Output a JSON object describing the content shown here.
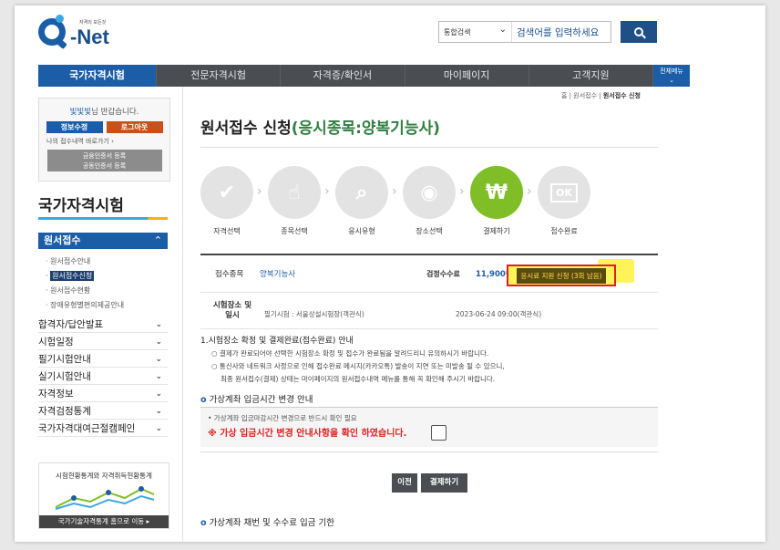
{
  "logo": {
    "tagline": "자격의 모든것",
    "name": "-Net"
  },
  "search": {
    "scope": "통합검색",
    "placeholder": "검색어를 입력하세요"
  },
  "nav": {
    "items": [
      "국가자격시험",
      "전문자격시험",
      "자격증/확인서",
      "마이페이지",
      "고객지원"
    ],
    "all_menu": "전체메뉴"
  },
  "user": {
    "name": "빛빛빛",
    "greeting": "님 반갑습니다.",
    "info_button": "정보수정",
    "logout_button": "로그아웃",
    "recent_link": "나의 접수내역 바로가기",
    "cert_button_line1": "금융인증서 등록",
    "cert_button_line2": "공동인증서 등록"
  },
  "sidebar": {
    "title": "국가자격시험",
    "section": "원서접수",
    "sub_items": [
      "원서접수안내",
      "원서접수신청",
      "원서접수현황",
      "장애유형별편의제공안내"
    ],
    "main_items": [
      "합격자/답안발표",
      "시험일정",
      "필기시험안내",
      "실기시험안내",
      "자격정보",
      "자격검정통계",
      "국가자격대여근절캠페인"
    ],
    "stats_title": "시험현황통계와 자격취득현황통계",
    "stats_link": "국가기술자격통계 홈으로 이동"
  },
  "breadcrumb": {
    "home": "홈",
    "parent": "원서접수",
    "current": "원서접수 신청"
  },
  "page": {
    "title": "원서접수 신청",
    "title_highlight": "(응시종목:양복기능사)"
  },
  "steps": [
    {
      "label": "자격선택",
      "icon": "✔"
    },
    {
      "label": "종목선택",
      "icon": "☝"
    },
    {
      "label": "응시유형",
      "icon": "⌕"
    },
    {
      "label": "장소선택",
      "icon": "◉"
    },
    {
      "label": "결제하기",
      "icon": "₩"
    },
    {
      "label": "접수완료",
      "icon": "OK"
    }
  ],
  "info": {
    "item_label": "접수종목",
    "item_value": "양복기능사",
    "fee_label": "검정수수료",
    "fee_value": "11,900원",
    "apply_button": "응시료 지원 신청 (3회 남음)",
    "place_label": "시험장소 및 일시",
    "place_value": "필기시험 : 서울상설시험장(객관식)",
    "date_value": "2023-06-24 09:00(객관식)"
  },
  "notice": {
    "heading": "1.시험장소 확정 및 결제완료(접수완료) 안내",
    "line1": "○ 결제가 완료되어야 선택한 시험장소 확정 및 접수가 완료됨을 알려드리니 유의하시기 바랍니다.",
    "line2": "○ 통신사와 네트워크 사정으로 인해 접수완료 메시지(카카오톡) 발송이 지연 또는 미발송 될 수 있으니,",
    "line3": "최종 원서접수(결제) 상태는 마이페이지의 원서접수내역 메뉴를 통해 꼭 확인해 주시기 바랍니다."
  },
  "virtual_account": {
    "title": "가상계좌 입금시간 변경 안내",
    "hint": "• 가상계좌 입금마감시간 변경으로 반드시 확인 필요",
    "confirm": "※ 가상 입금시간 변경 안내사항을 확인 하였습니다."
  },
  "buttons": {
    "prev": "이전",
    "pay": "결제하기"
  },
  "bottom_title": "가상계좌 채번 및 수수료 입금 기한"
}
